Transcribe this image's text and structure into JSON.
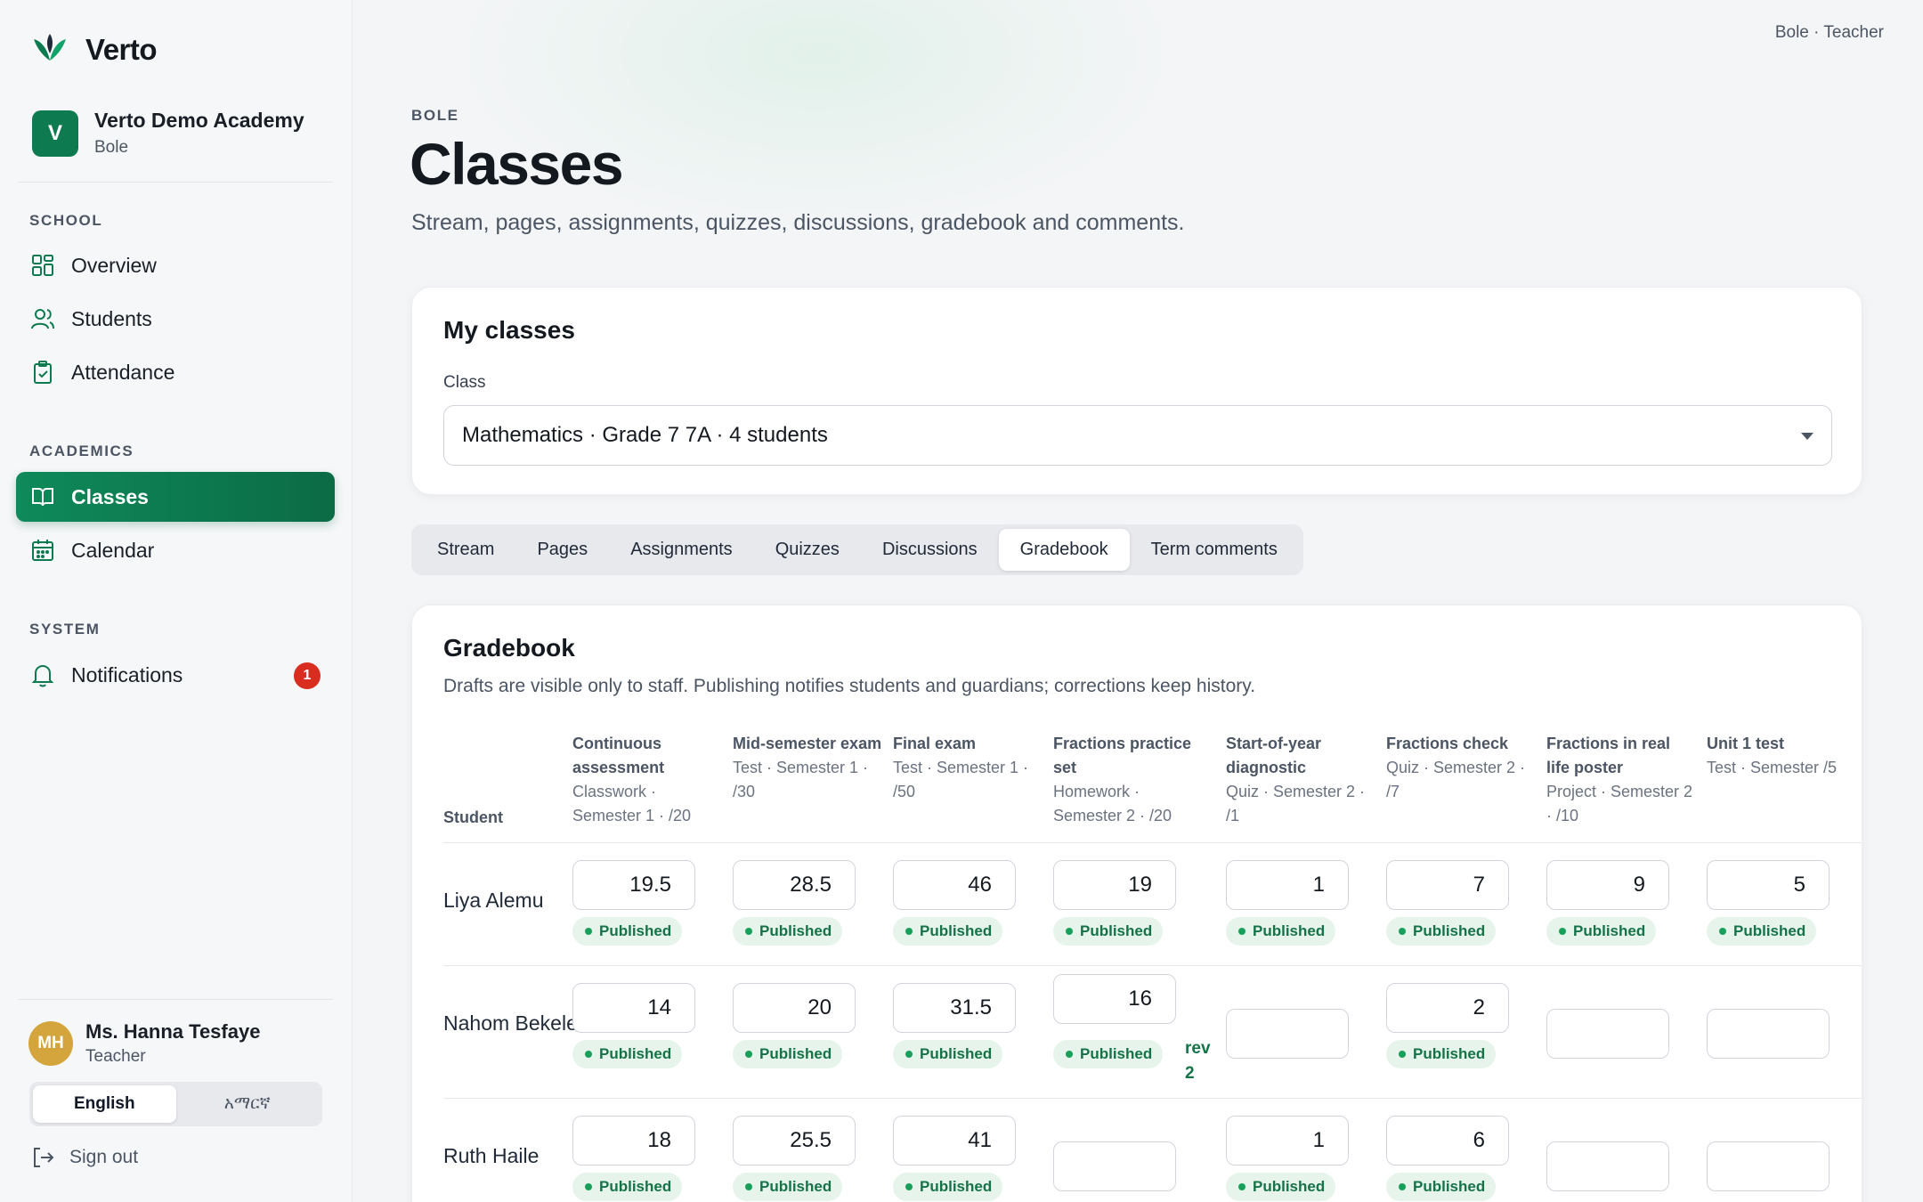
{
  "brand": {
    "name": "Verto",
    "logo_icon": "leaf-logo-icon"
  },
  "school": {
    "initial": "V",
    "name": "Verto Demo Academy",
    "branch": "Bole"
  },
  "sidebar": {
    "sections": [
      {
        "label": "SCHOOL",
        "items": [
          {
            "label": "Overview",
            "icon": "grid-icon"
          },
          {
            "label": "Students",
            "icon": "users-icon"
          },
          {
            "label": "Attendance",
            "icon": "clipboard-check-icon"
          }
        ]
      },
      {
        "label": "ACADEMICS",
        "items": [
          {
            "label": "Classes",
            "icon": "book-open-icon",
            "active": true
          },
          {
            "label": "Calendar",
            "icon": "calendar-icon"
          }
        ]
      },
      {
        "label": "SYSTEM",
        "items": [
          {
            "label": "Notifications",
            "icon": "bell-icon",
            "badge": "1"
          }
        ]
      }
    ]
  },
  "user": {
    "initials": "MH",
    "name": "Ms. Hanna Tesfaye",
    "role": "Teacher"
  },
  "language": {
    "options": [
      "English",
      "አማርኛ"
    ],
    "selected": "English"
  },
  "signout": {
    "label": "Sign out"
  },
  "topbar": {
    "user_label": "Bole · Teacher"
  },
  "page": {
    "eyebrow": "BOLE",
    "title": "Classes",
    "subtitle": "Stream, pages, assignments, quizzes, discussions, gradebook and comments."
  },
  "my_classes": {
    "title": "My classes",
    "field_label": "Class",
    "selected": "Mathematics · Grade 7 7A · 4 students"
  },
  "tabs": [
    "Stream",
    "Pages",
    "Assignments",
    "Quizzes",
    "Discussions",
    "Gradebook",
    "Term comments"
  ],
  "active_tab": "Gradebook",
  "gradebook": {
    "title": "Gradebook",
    "description": "Drafts are visible only to staff. Publishing notifies students and guardians; corrections keep history.",
    "student_header": "Student",
    "columns": [
      {
        "title": "Continuous assessment",
        "meta": "Classwork · Semester 1 · /20"
      },
      {
        "title": "Mid-semester exam",
        "meta": "Test · Semester 1 · /30"
      },
      {
        "title": "Final exam",
        "meta": "Test · Semester 1 · /50"
      },
      {
        "title": "Fractions practice set",
        "meta": "Homework · Semester 2 · /20"
      },
      {
        "title": "Start-of-year diagnostic",
        "meta": "Quiz · Semester 2 · /1"
      },
      {
        "title": "Fractions check",
        "meta": "Quiz · Semester 2 · /7"
      },
      {
        "title": "Fractions in real life poster",
        "meta": "Project · Semester 2 · /10"
      },
      {
        "title": "Unit 1 test",
        "meta": "Test · Semester /5"
      }
    ],
    "status_label": "Published",
    "rows": [
      {
        "student": "Liya Alemu",
        "scores": [
          "19.5",
          "28.5",
          "46",
          "19",
          "1",
          "7",
          "9",
          "5"
        ],
        "published": [
          true,
          true,
          true,
          true,
          true,
          true,
          true,
          true
        ]
      },
      {
        "student": "Nahom Bekele",
        "scores": [
          "14",
          "20",
          "31.5",
          "16",
          "",
          "2",
          "",
          ""
        ],
        "published": [
          true,
          true,
          true,
          true,
          false,
          true,
          false,
          false
        ],
        "revision_note": {
          "col": 3,
          "label": "rev 2"
        }
      },
      {
        "student": "Ruth Haile",
        "scores": [
          "18",
          "25.5",
          "41",
          "",
          "1",
          "6",
          "",
          ""
        ],
        "published": [
          true,
          true,
          true,
          false,
          true,
          true,
          false,
          false
        ]
      }
    ]
  },
  "colors": {
    "accent": "#0e7a4f",
    "badge": "#d92d20",
    "published_bg": "#e6f4ec",
    "published_text": "#157347"
  }
}
